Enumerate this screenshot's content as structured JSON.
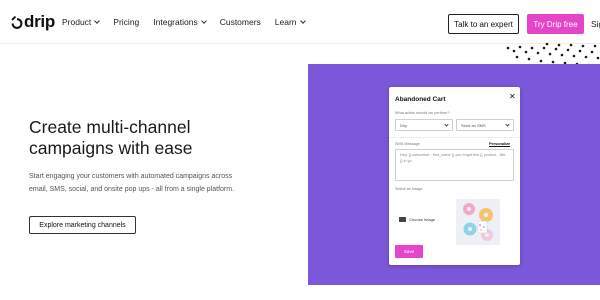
{
  "brand": {
    "logo_text": "drip",
    "accent": "#e545c9",
    "panel_color": "#7b58d9"
  },
  "nav": {
    "items": [
      {
        "label": "Product",
        "dropdown": true
      },
      {
        "label": "Pricing",
        "dropdown": false
      },
      {
        "label": "Integrations",
        "dropdown": true
      },
      {
        "label": "Customers",
        "dropdown": false
      },
      {
        "label": "Learn",
        "dropdown": true
      }
    ],
    "expert_button": "Talk to an expert",
    "try_button": "Try Drip free",
    "signin_partial": "Sig"
  },
  "hero": {
    "title": "Create multi-channel campaigns with ease",
    "subtitle": "Start engaging your customers with automated campaigns across email, SMS, social, and onsite pop ups - all from a single platform.",
    "cta": "Explore marketing channels"
  },
  "modal": {
    "title": "Abandoned Cart",
    "close_icon": "close-icon",
    "action_label": "What action should we perform?",
    "select_1": "Drip",
    "select_2": "Send an SMS",
    "sms_label": "SMS Message",
    "personalize": "Personalize",
    "sms_text": "Hey, {{ subscriber . first_name }} you forgot this {{ product . title }} in yo",
    "image_label": "Select an Image",
    "choose_image": "Choose Image",
    "image_icon": "image-icon",
    "save_button": "Save"
  }
}
